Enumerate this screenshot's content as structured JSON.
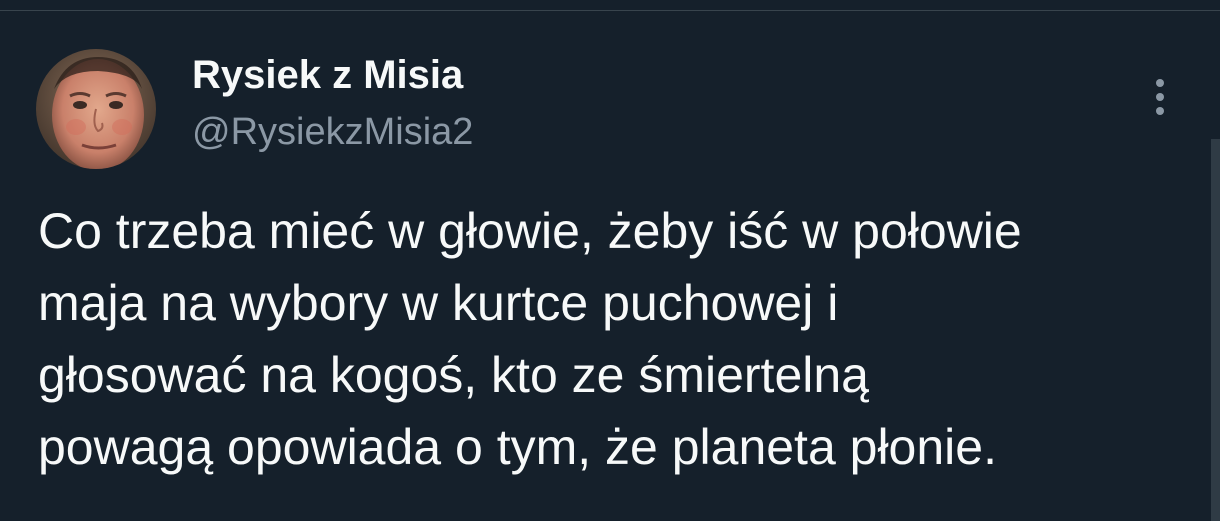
{
  "tweet": {
    "author": {
      "display_name": "Rysiek z Misia",
      "handle": "@RysiekzMisia2"
    },
    "more_icon": "more-vertical-icon",
    "text": "Co trzeba mieć w głowie, żeby iść w połowie\nmaja na wybory w kurtce puchowej i\ngłosować na kogoś, kto ze śmiertelną\npowagą opowiada o tym, że planeta płonie."
  },
  "colors": {
    "background": "#15202b",
    "primary_text": "#f7f9f9",
    "secondary_text": "#8b98a5",
    "divider": "#38444d"
  }
}
